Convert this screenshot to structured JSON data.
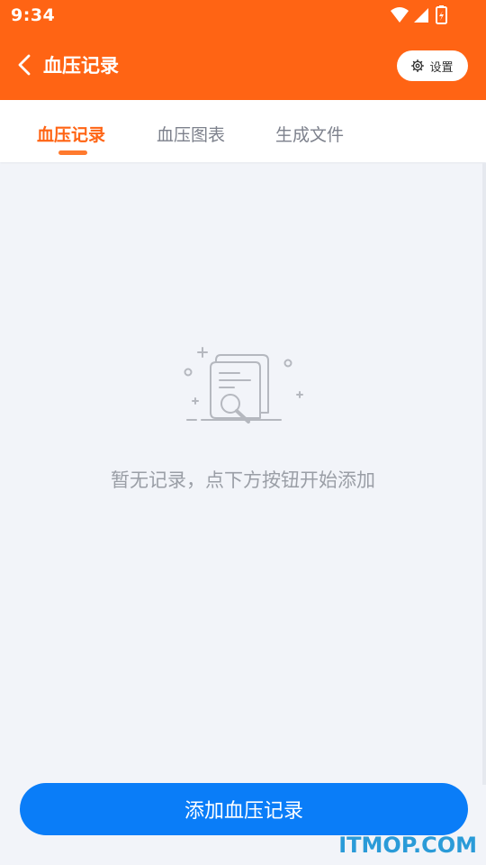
{
  "status_bar": {
    "time": "9:34"
  },
  "header": {
    "title": "血压记录",
    "settings_label": "设置"
  },
  "tabs": [
    {
      "label": "血压记录",
      "active": true
    },
    {
      "label": "血压图表",
      "active": false
    },
    {
      "label": "生成文件",
      "active": false
    }
  ],
  "empty_state": {
    "message": "暂无记录，点下方按钮开始添加"
  },
  "primary_action": {
    "label": "添加血压记录"
  },
  "watermark": {
    "text": "ITMOP.COM"
  },
  "colors": {
    "header": "#ff6414",
    "primary_button": "#0a7df8",
    "active_tab": "#ff6414"
  }
}
